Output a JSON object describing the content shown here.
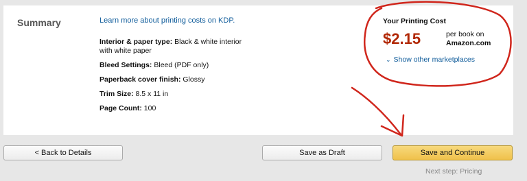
{
  "summary": {
    "title": "Summary",
    "kdp_link": "Learn more about printing costs on KDP."
  },
  "details": [
    {
      "label": "Interior & paper type:",
      "value": " Black & white interior with white paper"
    },
    {
      "label": "Bleed Settings:",
      "value": " Bleed (PDF only)"
    },
    {
      "label": "Paperback cover finish:",
      "value": " Glossy"
    },
    {
      "label": "Trim Size:",
      "value": " 8.5 x 11 in"
    },
    {
      "label": "Page Count:",
      "value": " 100"
    }
  ],
  "printing_cost": {
    "heading": "Your Printing Cost",
    "price": "$2.15",
    "per_book": "per book on",
    "marketplace": "Amazon.com",
    "other_marketplaces": "Show other marketplaces"
  },
  "footer": {
    "back_label": "< Back to Details",
    "draft_label": "Save as Draft",
    "continue_label": "Save and Continue",
    "next_step": "Next step: Pricing"
  },
  "colors": {
    "price": "#b12704",
    "link": "#0e5b9a",
    "continue_button": "#f0c14b",
    "annotation": "#d0261c"
  },
  "icons": {
    "marketplaces": "chevron-down-icon"
  }
}
